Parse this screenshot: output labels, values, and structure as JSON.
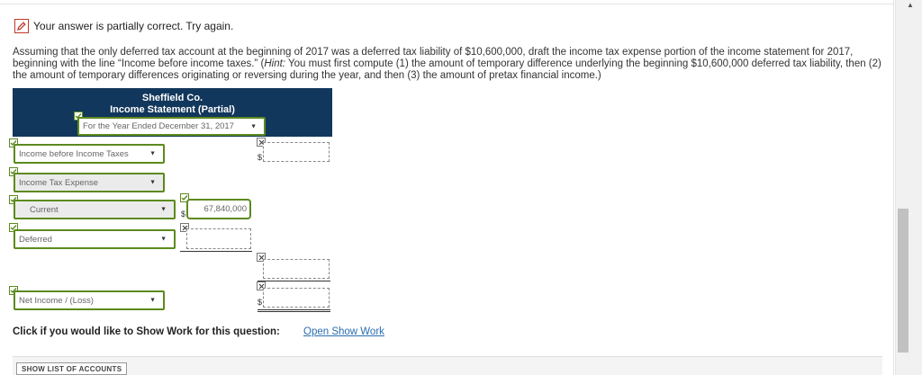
{
  "status": {
    "icon": "pencil-edit-icon",
    "text": "Your answer is partially correct.  Try again."
  },
  "question": {
    "lead": "Assuming that the only deferred tax account at the beginning of 2017 was a deferred tax liability of $10,600,000, draft the income tax expense portion of the income statement for 2017, beginning with the line “Income before income taxes.” (",
    "hint_label": "Hint:",
    "hint_text": " You must first compute (1) the amount of temporary difference underlying the beginning $10,600,000 deferred tax liability, then (2) the amount of temporary differences originating or reversing during the year, and then (3) the amount of pretax financial income.)"
  },
  "statement": {
    "company": "Sheffield Co.",
    "title": "Income Statement (Partial)",
    "period": "For the Year Ended December 31, 2017"
  },
  "rows": {
    "income_before_taxes": "Income before Income Taxes",
    "income_tax_expense": "Income Tax Expense",
    "current": "Current",
    "current_value": "67,840,000",
    "deferred": "Deferred",
    "net_income": "Net Income / (Loss)",
    "currency": "$"
  },
  "footer": {
    "show_work_prompt": "Click if you would like to Show Work for this question:",
    "show_work_link": "Open Show Work",
    "show_accounts": "SHOW LIST OF ACCOUNTS"
  },
  "colors": {
    "header_bg": "#12375c",
    "correct_green": "#5c8a1e",
    "incorrect_red": "#c0392b",
    "link_blue": "#2a6db0"
  }
}
